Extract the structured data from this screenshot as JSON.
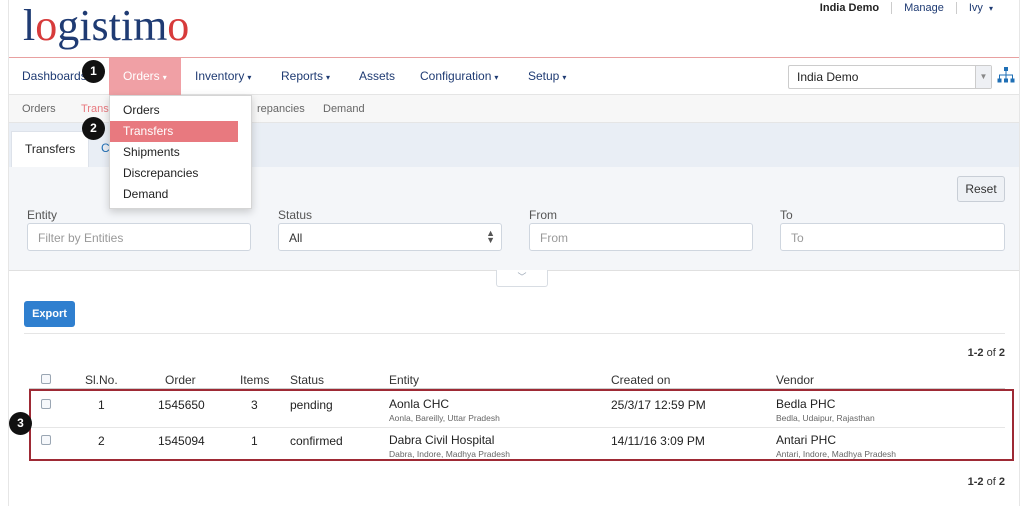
{
  "brand": {
    "logo_text": "logistimo"
  },
  "top_links": {
    "domain": "India Demo",
    "manage": "Manage",
    "user": "Ivy",
    "caret": "▾"
  },
  "nav": {
    "items": [
      {
        "label": "Dashboards"
      },
      {
        "label": "Orders",
        "caret": "▾"
      },
      {
        "label": "Inventory",
        "caret": "▾"
      },
      {
        "label": "Reports",
        "caret": "▾"
      },
      {
        "label": "Assets"
      },
      {
        "label": "Configuration",
        "caret": "▾"
      },
      {
        "label": "Setup",
        "caret": "▾"
      }
    ],
    "domain_select": "India Demo"
  },
  "subnav": {
    "items": [
      "Orders",
      "Transf",
      "repancies",
      "Demand"
    ]
  },
  "orders_menu": {
    "items": [
      "Orders",
      "Transfers",
      "Shipments",
      "Discrepancies",
      "Demand"
    ]
  },
  "tabs": {
    "active": "Transfers",
    "other": "C"
  },
  "filters": {
    "reset": "Reset",
    "entity": {
      "label": "Entity",
      "placeholder": "Filter by Entities"
    },
    "status": {
      "label": "Status",
      "value": "All"
    },
    "from": {
      "label": "From",
      "placeholder": "From"
    },
    "to": {
      "label": "To",
      "placeholder": "To"
    }
  },
  "export_label": "Export",
  "pagination": {
    "range": "1-2",
    "of": "of",
    "total": "2"
  },
  "table": {
    "headers": {
      "slno": "Sl.No.",
      "order": "Order",
      "items": "Items",
      "status": "Status",
      "entity": "Entity",
      "created": "Created on",
      "vendor": "Vendor"
    },
    "rows": [
      {
        "slno": "1",
        "order": "1545650",
        "items": "3",
        "status": "pending",
        "entity": "Aonla CHC",
        "entity_loc": "Aonla, Bareilly, Uttar Pradesh",
        "created": "25/3/17 12:59 PM",
        "vendor": "Bedla PHC",
        "vendor_loc": "Bedla, Udaipur, Rajasthan"
      },
      {
        "slno": "2",
        "order": "1545094",
        "items": "1",
        "status": "confirmed",
        "entity": "Dabra Civil Hospital",
        "entity_loc": "Dabra, Indore, Madhya Pradesh",
        "created": "14/11/16 3:09 PM",
        "vendor": "Antari PHC",
        "vendor_loc": "Antari, Indore, Madhya Pradesh"
      }
    ]
  },
  "steps": [
    "1",
    "2",
    "3"
  ],
  "colors": {
    "brand_blue": "#1f3b73",
    "accent_pink": "#e8797f",
    "export_blue": "#2f7fcf",
    "highlight": "#9e2a35"
  }
}
